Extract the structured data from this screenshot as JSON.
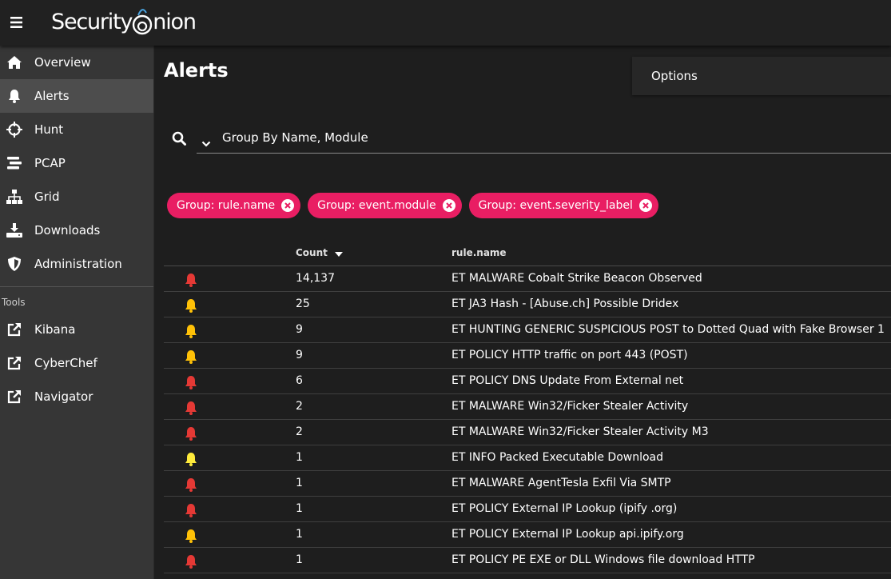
{
  "header": {
    "logo_text_left": "Security",
    "logo_text_right": "nion"
  },
  "sidebar": {
    "items": [
      {
        "label": "Overview",
        "icon": "home-icon"
      },
      {
        "label": "Alerts",
        "icon": "bell-icon",
        "active": true
      },
      {
        "label": "Hunt",
        "icon": "crosshairs-icon"
      },
      {
        "label": "PCAP",
        "icon": "stream-icon"
      },
      {
        "label": "Grid",
        "icon": "sitemap-icon"
      },
      {
        "label": "Downloads",
        "icon": "download-icon"
      },
      {
        "label": "Administration",
        "icon": "shield-icon"
      }
    ],
    "tools_label": "Tools",
    "tools": [
      {
        "label": "Kibana",
        "icon": "external-link-icon"
      },
      {
        "label": "CyberChef",
        "icon": "external-link-icon"
      },
      {
        "label": "Navigator",
        "icon": "external-link-icon"
      }
    ]
  },
  "main": {
    "title": "Alerts",
    "options_label": "Options",
    "query": "Group By Name, Module",
    "chips": [
      "Group: rule.name",
      "Group: event.module",
      "Group: event.severity_label"
    ],
    "table": {
      "headers": {
        "count": "Count",
        "rule": "rule.name"
      },
      "rows": [
        {
          "severity": "high",
          "count": "14,137",
          "rule": "ET MALWARE Cobalt Strike Beacon Observed"
        },
        {
          "severity": "medium",
          "count": "25",
          "rule": "ET JA3 Hash - [Abuse.ch] Possible Dridex"
        },
        {
          "severity": "medium",
          "count": "9",
          "rule": "ET HUNTING GENERIC SUSPICIOUS POST to Dotted Quad with Fake Browser 1"
        },
        {
          "severity": "medium",
          "count": "9",
          "rule": "ET POLICY HTTP traffic on port 443 (POST)"
        },
        {
          "severity": "high",
          "count": "6",
          "rule": "ET POLICY DNS Update From External net"
        },
        {
          "severity": "high",
          "count": "2",
          "rule": "ET MALWARE Win32/Ficker Stealer Activity"
        },
        {
          "severity": "high",
          "count": "2",
          "rule": "ET MALWARE Win32/Ficker Stealer Activity M3"
        },
        {
          "severity": "low",
          "count": "1",
          "rule": "ET INFO Packed Executable Download"
        },
        {
          "severity": "high",
          "count": "1",
          "rule": "ET MALWARE AgentTesla Exfil Via SMTP"
        },
        {
          "severity": "high",
          "count": "1",
          "rule": "ET POLICY External IP Lookup (ipify .org)"
        },
        {
          "severity": "medium",
          "count": "1",
          "rule": "ET POLICY External IP Lookup api.ipify.org"
        },
        {
          "severity": "high",
          "count": "1",
          "rule": "ET POLICY PE EXE or DLL Windows file download HTTP"
        }
      ]
    }
  },
  "colors": {
    "high": "#e53935",
    "medium": "#ffc107",
    "low": "#ffeb3b",
    "chip": "#e91e63"
  }
}
